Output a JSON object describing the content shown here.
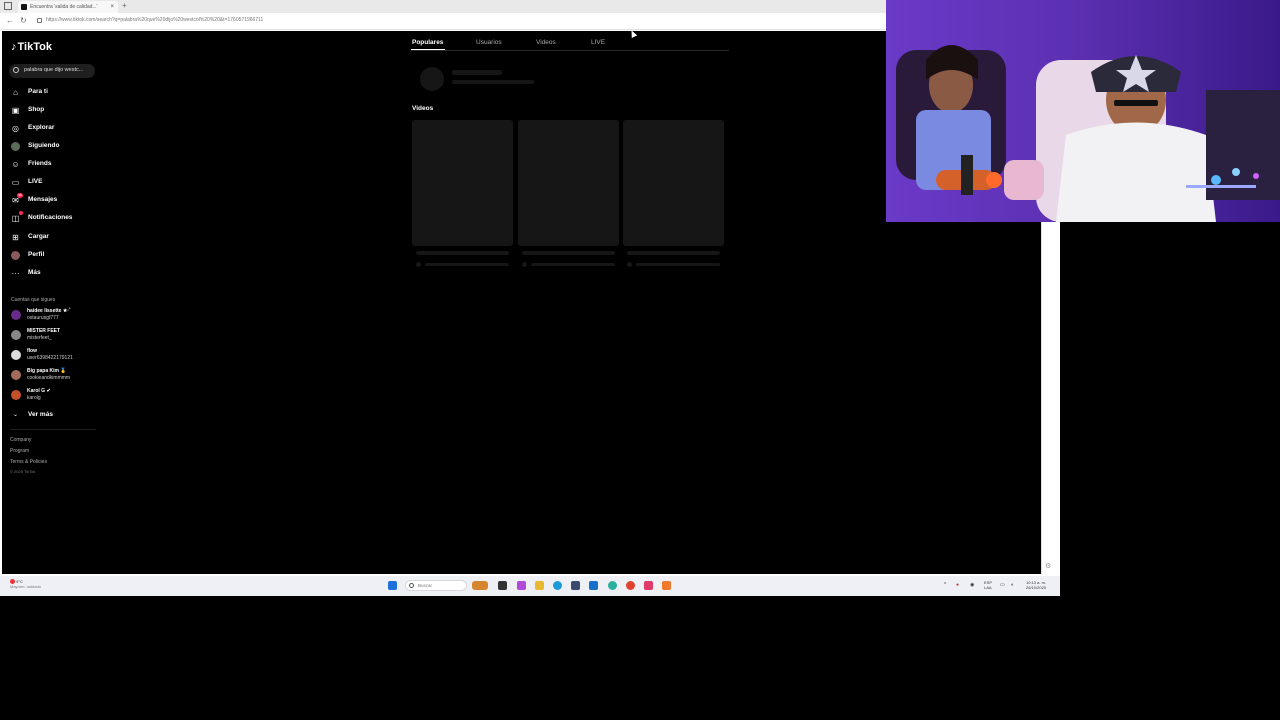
{
  "browser": {
    "tab_title": "Encuentra 'salida de calidad...'",
    "tab_close": "×",
    "new_tab": "+",
    "url": "https://www.tiktok.com/search?q=palabra%20que%20dijo%20westcol%20%20&t=1760571966711"
  },
  "sidebar": {
    "logo": "TikTok",
    "search_value": "palabra que dijo westc...",
    "menu": [
      {
        "label": "Para ti",
        "icon": "home-icon"
      },
      {
        "label": "Shop",
        "icon": "shop-icon"
      },
      {
        "label": "Explorar",
        "icon": "compass-icon"
      },
      {
        "label": "Siguiendo",
        "icon": "following-icon"
      },
      {
        "label": "Friends",
        "icon": "friends-icon"
      },
      {
        "label": "LIVE",
        "icon": "live-icon"
      },
      {
        "label": "Mensajes",
        "icon": "messages-icon",
        "badge": "99"
      },
      {
        "label": "Notificaciones",
        "icon": "notifications-icon"
      },
      {
        "label": "Cargar",
        "icon": "upload-icon"
      },
      {
        "label": "Perfil",
        "icon": "profile-icon"
      },
      {
        "label": "Más",
        "icon": "more-icon"
      }
    ],
    "following_title": "Cuentas que sigues",
    "following": [
      {
        "name": "haidee lissette ★·˚",
        "handle": "oxtaurusgf777"
      },
      {
        "name": "MISTER FEET",
        "handle": "misterfeet_"
      },
      {
        "name": "flow",
        "handle": "user6398422179121"
      },
      {
        "name": "Big papa Kim 🥇",
        "handle": "cookieandkimmmm"
      },
      {
        "name": "Karol G ✔",
        "handle": "karolg"
      }
    ],
    "see_more": "Ver más",
    "footer": [
      "Company",
      "Program",
      "Terms & Policies",
      "© 2025 TikTok"
    ]
  },
  "main": {
    "tabs": [
      "Populares",
      "Usuarios",
      "Videos",
      "LIVE"
    ],
    "active_tab": "Populares",
    "videos_heading": "Videos"
  },
  "taskbar": {
    "weather_temp": "9°C",
    "weather_desc": "Mayorm. nublado",
    "search_placeholder": "Buscar",
    "lang": "ESP",
    "lang_sub": "LAA",
    "time": "10:13 a. m.",
    "date": "26/10/2025"
  },
  "colors": {
    "accent": "#fe2c55",
    "page_bg": "#000000",
    "skeleton": "#161616"
  }
}
